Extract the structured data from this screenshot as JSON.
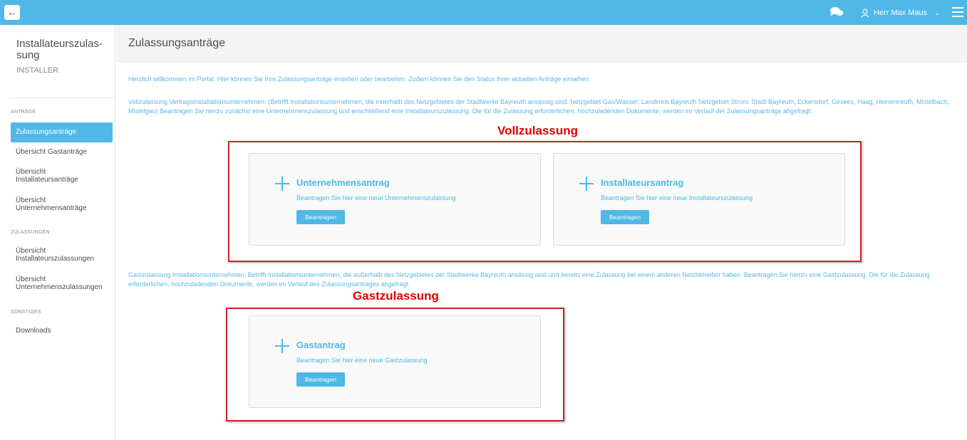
{
  "topbar": {
    "back_label": "←",
    "user_name": "Herr Max Maus",
    "user_chevron": "⌄"
  },
  "sidebar": {
    "title": "Installateurszulas-sung",
    "subtitle": "INSTALLER",
    "sections": [
      {
        "label": "ANTRÄGE"
      },
      {
        "label": "ZULASSUNGEN"
      },
      {
        "label": "SONSTIGES"
      }
    ],
    "items": [
      {
        "label": "Zulassungsanträge"
      },
      {
        "label": "Übersicht Gastanträge"
      },
      {
        "label": "Übersicht Installateursanträge"
      },
      {
        "label": "Übersicht Unternehmensanträge"
      },
      {
        "label": "Übersicht Installateurszulassungen"
      },
      {
        "label": "Übersicht Unternehmenszulassungen"
      },
      {
        "label": "Downloads"
      }
    ]
  },
  "main": {
    "title": "Zulassungsanträge",
    "welcome": "Herzlich willkommen im Portal. Hier können Sie Ihre Zulassungsanträge erstellen oder bearbeiten. Zudem können Sie den Status Ihrer aktuellen Anträge einsehen.",
    "voll_text": "Vollzulassung Vertragsinstallationsunternehmen: (Betrifft Installationsunternehmen, die innerhalb des Netzgebietes der Stadtwerke Bayreuth ansässig sind. Netzgebiet Gas/Wasser: Landkreis Bayreuth Netzgebiet Strom: Stadt Bayreuth, Eckersdorf, Gesees, Haag, Heinersreuth, Mistelbach, Mistelgau) Beantragen Sie hierzu zunächst eine Unternehmenszulassung und anschließend eine Installateurszulassung. Die für die Zulassung erforderlichen, hochzuladenden Dokumente, werden im Verlauf der Zulassungsanträge abgefragt.",
    "gast_text": "Gastzulassung Installationsunternehmen: Betrifft Installationsunternehmen, die außerhalb des Netzgebietes der Stadtwerke Bayreuth ansässig sind und bereits eine Zulassung bei einem anderen Netzbetreiber haben. Beantragen Sie hierzu eine Gastzulassung. Die für die Zulassung erforderlichen, hochzuladenden Dokumente, werden im Verlauf des Zulassungsantrages abgefragt.",
    "annotations": {
      "voll": "Vollzulassung",
      "gast": "Gastzulassung"
    },
    "cards": [
      {
        "title": "Unternehmensantrag",
        "desc": "Beantragen Sie hier eine neue Unternehmenszulassung",
        "button": "Beantragen"
      },
      {
        "title": "Installateursantrag",
        "desc": "Beantragen Sie hier eine neue Installateurszulassung",
        "button": "Beantragen"
      },
      {
        "title": "Gastantrag",
        "desc": "Beantragen Sie hier eine neue Gastzulassung",
        "button": "Beantragen"
      }
    ]
  },
  "colors": {
    "accent": "#4fb8e6",
    "annotation": "#e00000"
  }
}
